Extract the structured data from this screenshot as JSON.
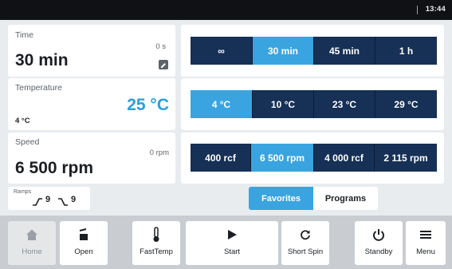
{
  "status_bar": {
    "time": "13:44"
  },
  "time_card": {
    "title": "Time",
    "remaining": "0 s",
    "value": "30 min"
  },
  "temperature_card": {
    "title": "Temperature",
    "current": "4 °C",
    "setpoint": "25 °C"
  },
  "speed_card": {
    "title": "Speed",
    "current": "0 rpm",
    "value": "6 500 rpm"
  },
  "ramps": {
    "label": "Ramps",
    "up_value": "9",
    "down_value": "9"
  },
  "time_presets": [
    {
      "label": "∞",
      "active": false
    },
    {
      "label": "30 min",
      "active": true
    },
    {
      "label": "45 min",
      "active": false
    },
    {
      "label": "1 h",
      "active": false
    }
  ],
  "temperature_presets": [
    {
      "label": "4 °C",
      "active": true
    },
    {
      "label": "10 °C",
      "active": false
    },
    {
      "label": "23 °C",
      "active": false
    },
    {
      "label": "29 °C",
      "active": false
    }
  ],
  "speed_presets": [
    {
      "label": "400 rcf",
      "active": false
    },
    {
      "label": "6 500 rpm",
      "active": true
    },
    {
      "label": "4 000 rcf",
      "active": false
    },
    {
      "label": "2 115 rpm",
      "active": false
    }
  ],
  "preset_tabs": {
    "favorites": "Favorites",
    "programs": "Programs",
    "selected": "favorites"
  },
  "toolbar": {
    "home": "Home",
    "open": "Open",
    "fasttemp": "FastTemp",
    "start": "Start",
    "short_spin": "Short Spin",
    "standby": "Standby",
    "menu": "Menu"
  },
  "colors": {
    "accent": "#39a4e0",
    "button_dark": "#163056",
    "highlight_text": "#2a9fd8",
    "background": "#e9ecef"
  },
  "icons": [
    "home-icon",
    "lid-open-icon",
    "thermometer-icon",
    "play-icon",
    "short-spin-icon",
    "power-icon",
    "menu-icon",
    "edit-icon",
    "ramp-up-icon",
    "ramp-down-icon"
  ]
}
